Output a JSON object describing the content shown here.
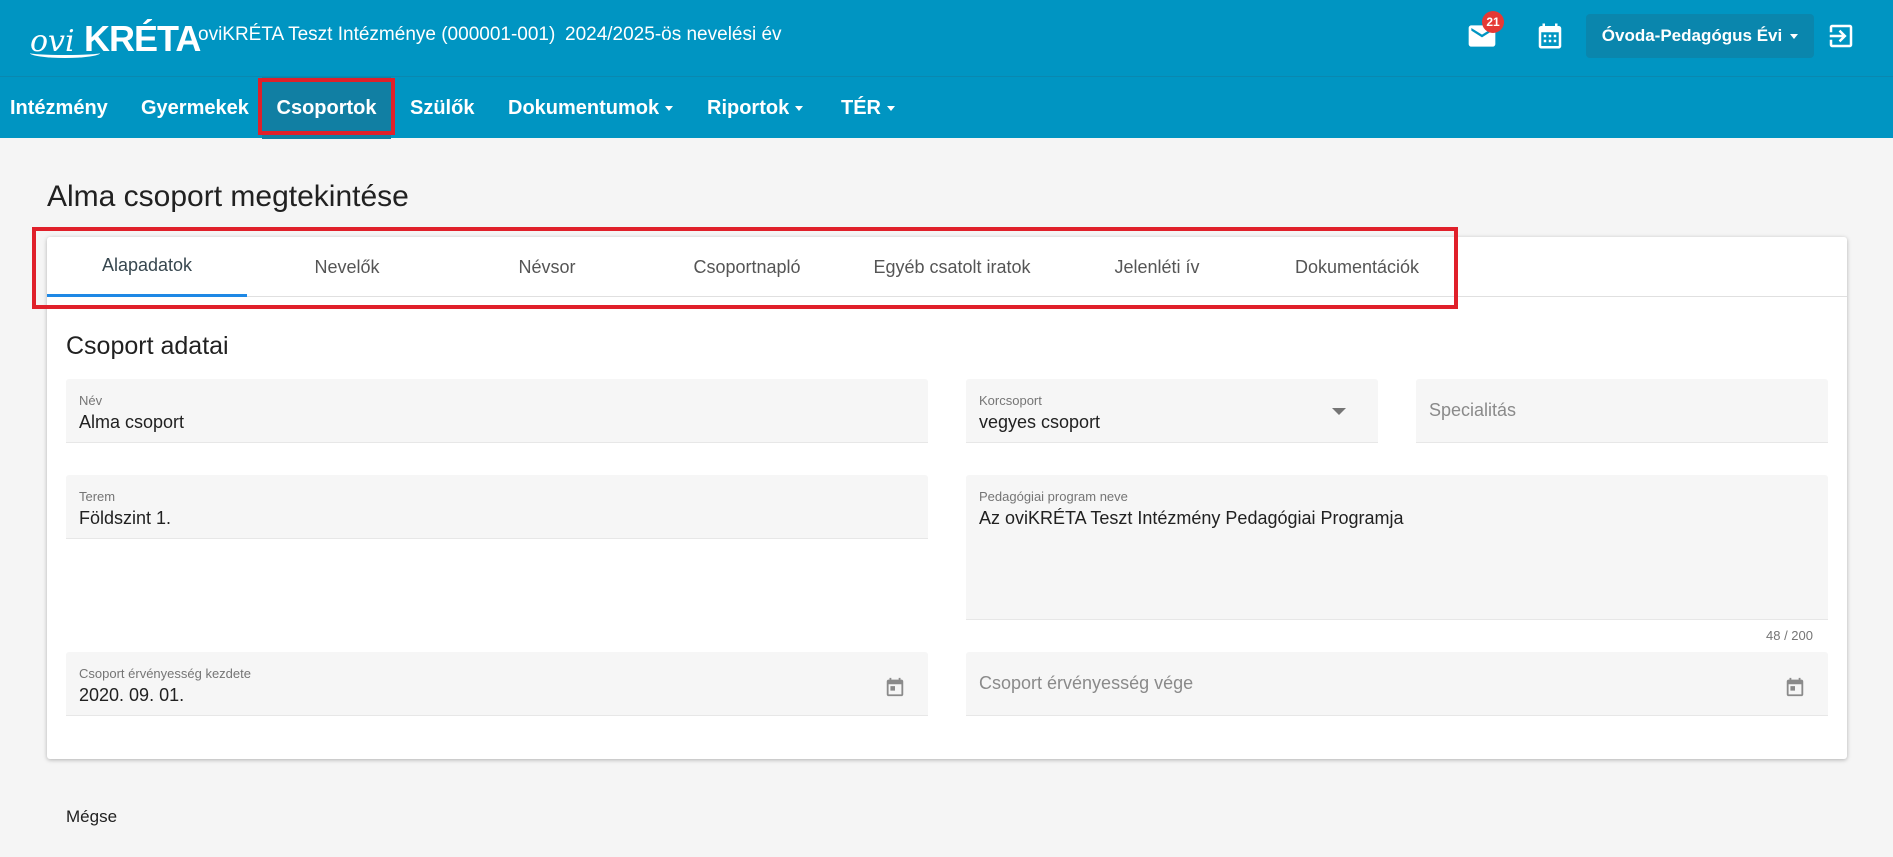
{
  "header": {
    "logo": "oviKRÉTA",
    "institution": "oviKRÉTA Teszt Intézménye (000001-001)",
    "school_year": "2024/2025-ös nevelési év",
    "mail_badge": "21",
    "role": "Óvoda-Pedagógus Évi"
  },
  "nav": {
    "items": [
      {
        "label": "Intézmény"
      },
      {
        "label": "Gyermekek"
      },
      {
        "label": "Csoportok"
      },
      {
        "label": "Szülők"
      },
      {
        "label": "Dokumentumok"
      },
      {
        "label": "Riportok"
      },
      {
        "label": "TÉR"
      }
    ]
  },
  "page": {
    "title": "Alma csoport megtekintése"
  },
  "tabs": [
    {
      "label": "Alapadatok"
    },
    {
      "label": "Nevelők"
    },
    {
      "label": "Névsor"
    },
    {
      "label": "Csoportnapló"
    },
    {
      "label": "Egyéb csatolt iratok"
    },
    {
      "label": "Jelenléti ív"
    },
    {
      "label": "Dokumentációk"
    }
  ],
  "form": {
    "section_title": "Csoport adatai",
    "name": {
      "label": "Név",
      "value": "Alma csoport"
    },
    "age_group": {
      "label": "Korcsoport",
      "value": "vegyes csoport"
    },
    "specialty": {
      "placeholder": "Specialitás"
    },
    "room": {
      "label": "Terem",
      "value": "Földszint 1."
    },
    "program": {
      "label": "Pedagógiai program neve",
      "value": "Az oviKRÉTA Teszt Intézmény Pedagógiai Programja",
      "counter": "48 / 200"
    },
    "valid_from": {
      "label": "Csoport érvényesség kezdete",
      "value": "2020. 09. 01."
    },
    "valid_to": {
      "placeholder": "Csoport érvényesség vége"
    }
  },
  "actions": {
    "cancel": "Mégse"
  }
}
